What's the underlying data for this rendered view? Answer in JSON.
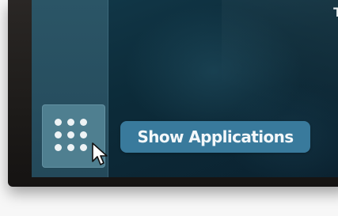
{
  "dock": {
    "show_apps_icon": "grid-dots-icon",
    "tooltip_label": "Show Applications"
  },
  "top_bar": {
    "partial_text": "T"
  },
  "colors": {
    "dock_bg": "#2b5566",
    "button_bg": "#4f7f90",
    "tooltip_bg": "#397a9c",
    "desktop_bg": "#12394a"
  }
}
